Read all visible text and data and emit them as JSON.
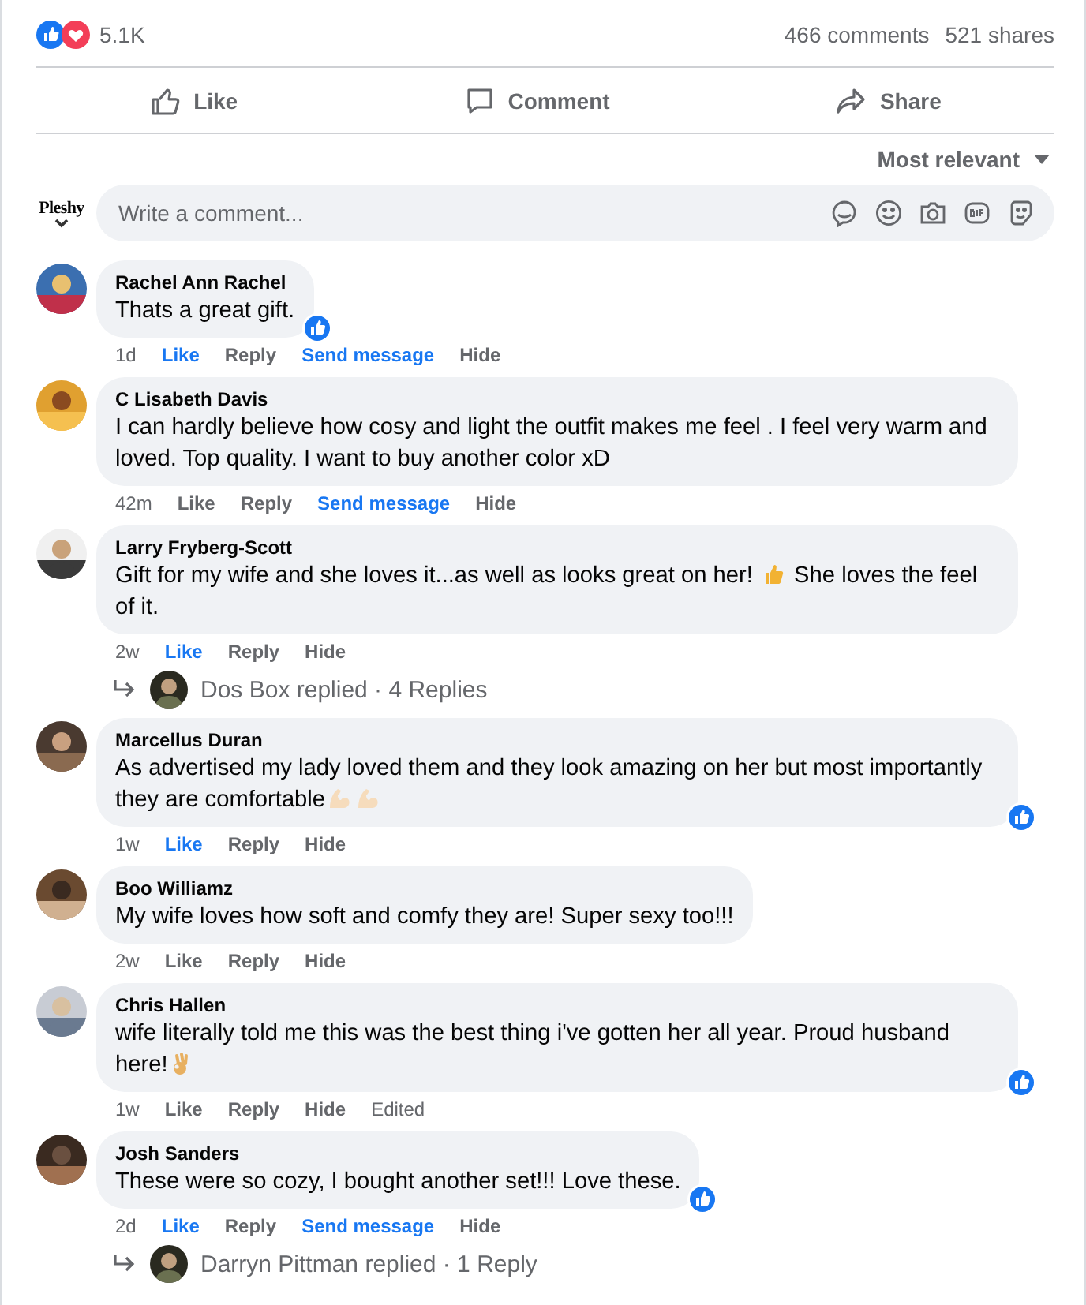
{
  "reactions": {
    "count": "5.1K"
  },
  "stats": {
    "comments": "466 comments",
    "shares": "521 shares"
  },
  "actions": [
    {
      "kind": "like",
      "label": "Like"
    },
    {
      "kind": "comment",
      "label": "Comment"
    },
    {
      "kind": "share",
      "label": "Share"
    }
  ],
  "sort": {
    "label": "Most relevant"
  },
  "composer": {
    "avatar_label": "Pleshy",
    "placeholder": "Write a comment..."
  },
  "comments": [
    {
      "name": "Rachel Ann Rachel",
      "segments": [
        {
          "kind": "text",
          "text": "Thats a great gift."
        }
      ],
      "reacted": true,
      "time": "1d",
      "links": [
        {
          "kind": "like",
          "label": "Like",
          "liked": true
        },
        {
          "kind": "reply",
          "label": "Reply"
        },
        {
          "kind": "message",
          "label": "Send message"
        },
        {
          "kind": "hide",
          "label": "Hide"
        }
      ]
    },
    {
      "name": "C Lisabeth Davis",
      "segments": [
        {
          "kind": "text",
          "text": "I can hardly believe how cosy and light the outfit makes me feel . I feel very warm and loved. Top quality. I want to buy another color xD"
        }
      ],
      "reacted": false,
      "time": "42m",
      "links": [
        {
          "kind": "like",
          "label": "Like",
          "liked": false
        },
        {
          "kind": "reply",
          "label": "Reply"
        },
        {
          "kind": "message",
          "label": "Send message"
        },
        {
          "kind": "hide",
          "label": "Hide"
        }
      ]
    },
    {
      "name": "Larry Fryberg-Scott",
      "segments": [
        {
          "kind": "text",
          "text": "Gift for my wife and she loves it...as well as looks great on her! "
        },
        {
          "kind": "thumb"
        },
        {
          "kind": "text",
          "text": " She loves the feel of it."
        }
      ],
      "reacted": false,
      "time": "2w",
      "links": [
        {
          "kind": "like",
          "label": "Like",
          "liked": true
        },
        {
          "kind": "reply",
          "label": "Reply"
        },
        {
          "kind": "hide",
          "label": "Hide"
        }
      ],
      "replies": {
        "text": "Dos Box replied · 4 Replies"
      }
    },
    {
      "name": "Marcellus Duran",
      "segments": [
        {
          "kind": "text",
          "text": "As advertised my lady loved them and they look amazing on her but most importantly they are comfortable"
        },
        {
          "kind": "flex"
        },
        {
          "kind": "flex"
        }
      ],
      "reacted": true,
      "time": "1w",
      "links": [
        {
          "kind": "like",
          "label": "Like",
          "liked": true
        },
        {
          "kind": "reply",
          "label": "Reply"
        },
        {
          "kind": "hide",
          "label": "Hide"
        }
      ]
    },
    {
      "name": "Boo Williamz",
      "segments": [
        {
          "kind": "text",
          "text": "My wife loves how soft and comfy they are! Super sexy too!!!"
        }
      ],
      "reacted": false,
      "time": "2w",
      "links": [
        {
          "kind": "like",
          "label": "Like",
          "liked": false
        },
        {
          "kind": "reply",
          "label": "Reply"
        },
        {
          "kind": "hide",
          "label": "Hide"
        }
      ]
    },
    {
      "name": "Chris Hallen",
      "segments": [
        {
          "kind": "text",
          "text": "wife literally told me this was the best thing i've gotten her all year. Proud husband here!"
        },
        {
          "kind": "ok"
        }
      ],
      "reacted": true,
      "time": "1w",
      "links": [
        {
          "kind": "like",
          "label": "Like",
          "liked": false
        },
        {
          "kind": "reply",
          "label": "Reply"
        },
        {
          "kind": "hide",
          "label": "Hide"
        }
      ],
      "edited": "Edited"
    },
    {
      "name": "Josh Sanders",
      "segments": [
        {
          "kind": "text",
          "text": "These were so cozy, I bought another set!!! Love these."
        }
      ],
      "reacted": true,
      "time": "2d",
      "links": [
        {
          "kind": "like",
          "label": "Like",
          "liked": true
        },
        {
          "kind": "reply",
          "label": "Reply"
        },
        {
          "kind": "message",
          "label": "Send message"
        },
        {
          "kind": "hide",
          "label": "Hide"
        }
      ],
      "replies": {
        "text": "Darryn Pittman replied · 1 Reply"
      }
    }
  ]
}
